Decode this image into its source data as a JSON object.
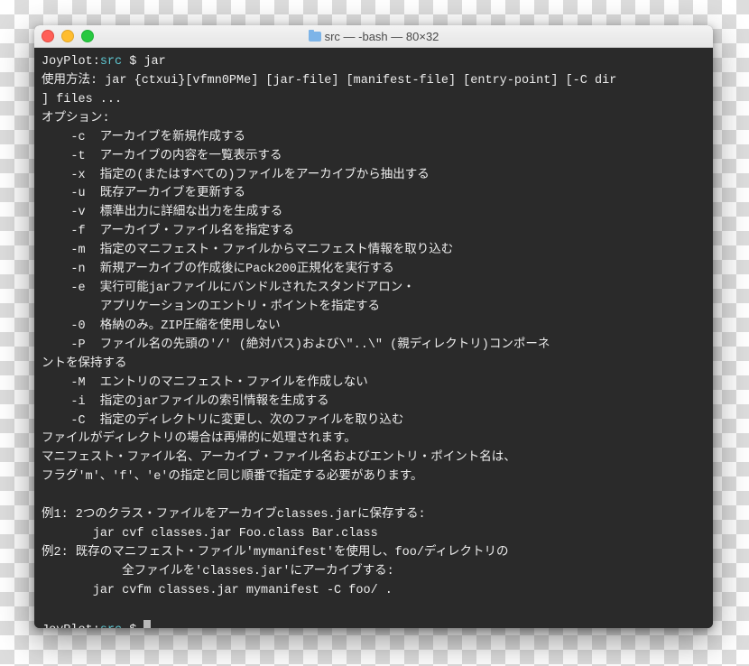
{
  "window": {
    "title_text": "src — -bash — 80×32"
  },
  "prompt": {
    "host": "JoyPlot:",
    "dir": "src",
    "dollar": " $ ",
    "cmd1": "jar",
    "cmd2": ""
  },
  "lines": {
    "l01": "使用方法: jar {ctxui}[vfmn0PMe] [jar-file] [manifest-file] [entry-point] [-C dir",
    "l02": "] files ...",
    "l03": "オプション:",
    "l04": "    -c  アーカイブを新規作成する",
    "l05": "    -t  アーカイブの内容を一覧表示する",
    "l06": "    -x  指定の(またはすべての)ファイルをアーカイブから抽出する",
    "l07": "    -u  既存アーカイブを更新する",
    "l08": "    -v  標準出力に詳細な出力を生成する",
    "l09": "    -f  アーカイブ・ファイル名を指定する",
    "l10": "    -m  指定のマニフェスト・ファイルからマニフェスト情報を取り込む",
    "l11": "    -n  新規アーカイブの作成後にPack200正規化を実行する",
    "l12": "    -e  実行可能jarファイルにバンドルされたスタンドアロン・",
    "l13": "        アプリケーションのエントリ・ポイントを指定する",
    "l14": "    -0  格納のみ。ZIP圧縮を使用しない",
    "l15": "    -P  ファイル名の先頭の'/' (絶対パス)および\\\"..\\\" (親ディレクトリ)コンポーネ",
    "l16": "ントを保持する",
    "l17": "    -M  エントリのマニフェスト・ファイルを作成しない",
    "l18": "    -i  指定のjarファイルの索引情報を生成する",
    "l19": "    -C  指定のディレクトリに変更し、次のファイルを取り込む",
    "l20": "ファイルがディレクトリの場合は再帰的に処理されます。",
    "l21": "マニフェスト・ファイル名、アーカイブ・ファイル名およびエントリ・ポイント名は、",
    "l22": "フラグ'm'、'f'、'e'の指定と同じ順番で指定する必要があります。",
    "l23": "",
    "l24": "例1: 2つのクラス・ファイルをアーカイブclasses.jarに保存する:",
    "l25": "       jar cvf classes.jar Foo.class Bar.class",
    "l26": "例2: 既存のマニフェスト・ファイル'mymanifest'を使用し、foo/ディレクトリの",
    "l27": "           全ファイルを'classes.jar'にアーカイブする:",
    "l28": "       jar cvfm classes.jar mymanifest -C foo/ .",
    "l29": ""
  }
}
